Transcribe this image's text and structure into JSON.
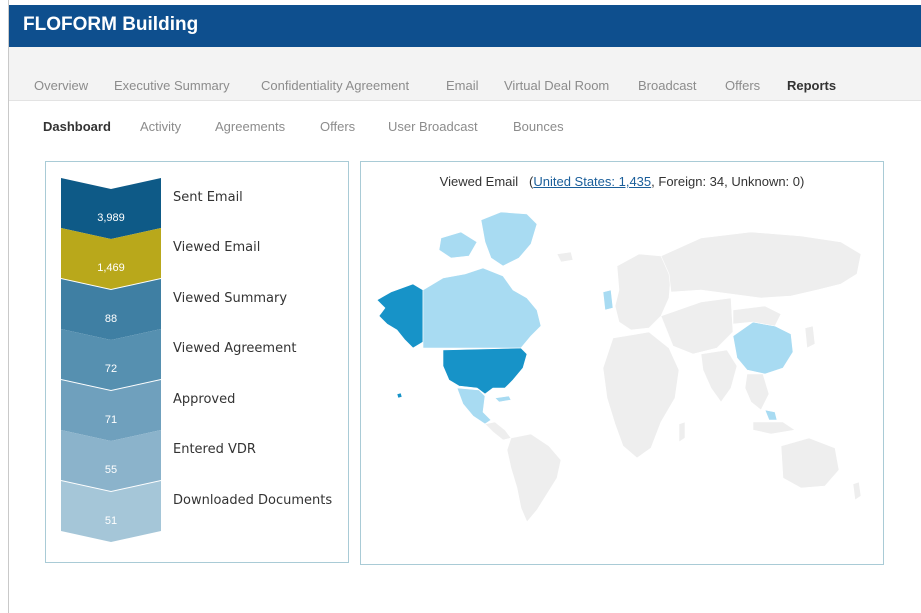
{
  "app": {
    "title": "FLOFORM Building"
  },
  "main_tabs": [
    {
      "label": "Overview",
      "active": false
    },
    {
      "label": "Executive Summary",
      "active": false
    },
    {
      "label": "Confidentiality Agreement",
      "active": false
    },
    {
      "label": "Email",
      "active": false
    },
    {
      "label": "Virtual Deal Room",
      "active": false
    },
    {
      "label": "Broadcast",
      "active": false
    },
    {
      "label": "Offers",
      "active": false
    },
    {
      "label": "Reports",
      "active": true
    }
  ],
  "sub_tabs": [
    {
      "label": "Dashboard",
      "active": true
    },
    {
      "label": "Activity",
      "active": false
    },
    {
      "label": "Agreements",
      "active": false
    },
    {
      "label": "Offers",
      "active": false
    },
    {
      "label": "User Broadcast",
      "active": false
    },
    {
      "label": "Bounces",
      "active": false
    }
  ],
  "funnel": [
    {
      "label": "Sent Email",
      "value": "3,989",
      "color": "#0e5a87"
    },
    {
      "label": "Viewed Email",
      "value": "1,469",
      "color": "#b9a81b"
    },
    {
      "label": "Viewed Summary",
      "value": "88",
      "color": "#3f7fa3"
    },
    {
      "label": "Viewed Agreement",
      "value": "72",
      "color": "#5690b0"
    },
    {
      "label": "Approved",
      "value": "71",
      "color": "#6fa0bd"
    },
    {
      "label": "Entered VDR",
      "value": "55",
      "color": "#8bb3cb"
    },
    {
      "label": "Downloaded Documents",
      "value": "51",
      "color": "#a5c6d8"
    }
  ],
  "map": {
    "caption_prefix": "Viewed Email",
    "us_link": "United States: 1,435",
    "caption_suffix": ", Foreign: 34, Unknown: 0)",
    "colors": {
      "land": "#eeeeee",
      "border": "#ffffff",
      "high": "#1793c8",
      "low": "#a8dbf2"
    },
    "highlighted_regions": {
      "high": [
        "United States",
        "Alaska"
      ],
      "low": [
        "Canada",
        "Greenland",
        "China",
        "Mexico",
        "United Kingdom",
        "Philippines",
        "Cuba"
      ]
    }
  }
}
